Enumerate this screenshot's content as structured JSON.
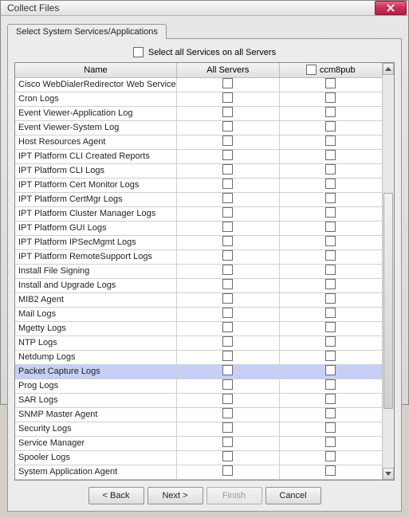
{
  "window": {
    "title": "Collect Files"
  },
  "tab": {
    "label": "Select System Services/Applications"
  },
  "selectAll": {
    "label": "Select all Services on all Servers"
  },
  "columns": {
    "name": "Name",
    "allServers": "All Servers",
    "server1": "ccm8pub"
  },
  "rows": [
    {
      "name": "Cisco WebDialerRedirector Web Service",
      "selected": false
    },
    {
      "name": "Cron Logs",
      "selected": false
    },
    {
      "name": "Event Viewer-Application Log",
      "selected": false
    },
    {
      "name": "Event Viewer-System Log",
      "selected": false
    },
    {
      "name": "Host Resources Agent",
      "selected": false
    },
    {
      "name": "IPT Platform CLI Created Reports",
      "selected": false
    },
    {
      "name": "IPT Platform CLI Logs",
      "selected": false
    },
    {
      "name": "IPT Platform Cert Monitor Logs",
      "selected": false
    },
    {
      "name": "IPT Platform CertMgr Logs",
      "selected": false
    },
    {
      "name": "IPT Platform Cluster Manager Logs",
      "selected": false
    },
    {
      "name": "IPT Platform GUI Logs",
      "selected": false
    },
    {
      "name": "IPT Platform IPSecMgmt Logs",
      "selected": false
    },
    {
      "name": "IPT Platform RemoteSupport Logs",
      "selected": false
    },
    {
      "name": "Install File Signing",
      "selected": false
    },
    {
      "name": "Install and Upgrade Logs",
      "selected": false
    },
    {
      "name": "MIB2 Agent",
      "selected": false
    },
    {
      "name": "Mail Logs",
      "selected": false
    },
    {
      "name": "Mgetty Logs",
      "selected": false
    },
    {
      "name": "NTP Logs",
      "selected": false
    },
    {
      "name": "Netdump Logs",
      "selected": false
    },
    {
      "name": "Packet Capture Logs",
      "selected": true
    },
    {
      "name": "Prog Logs",
      "selected": false
    },
    {
      "name": "SAR Logs",
      "selected": false
    },
    {
      "name": "SNMP Master Agent",
      "selected": false
    },
    {
      "name": "Security Logs",
      "selected": false
    },
    {
      "name": "Service Manager",
      "selected": false
    },
    {
      "name": "Spooler Logs",
      "selected": false
    },
    {
      "name": "System Application Agent",
      "selected": false
    }
  ],
  "buttons": {
    "back": "< Back",
    "next": "Next >",
    "finish": "Finish",
    "cancel": "Cancel"
  }
}
